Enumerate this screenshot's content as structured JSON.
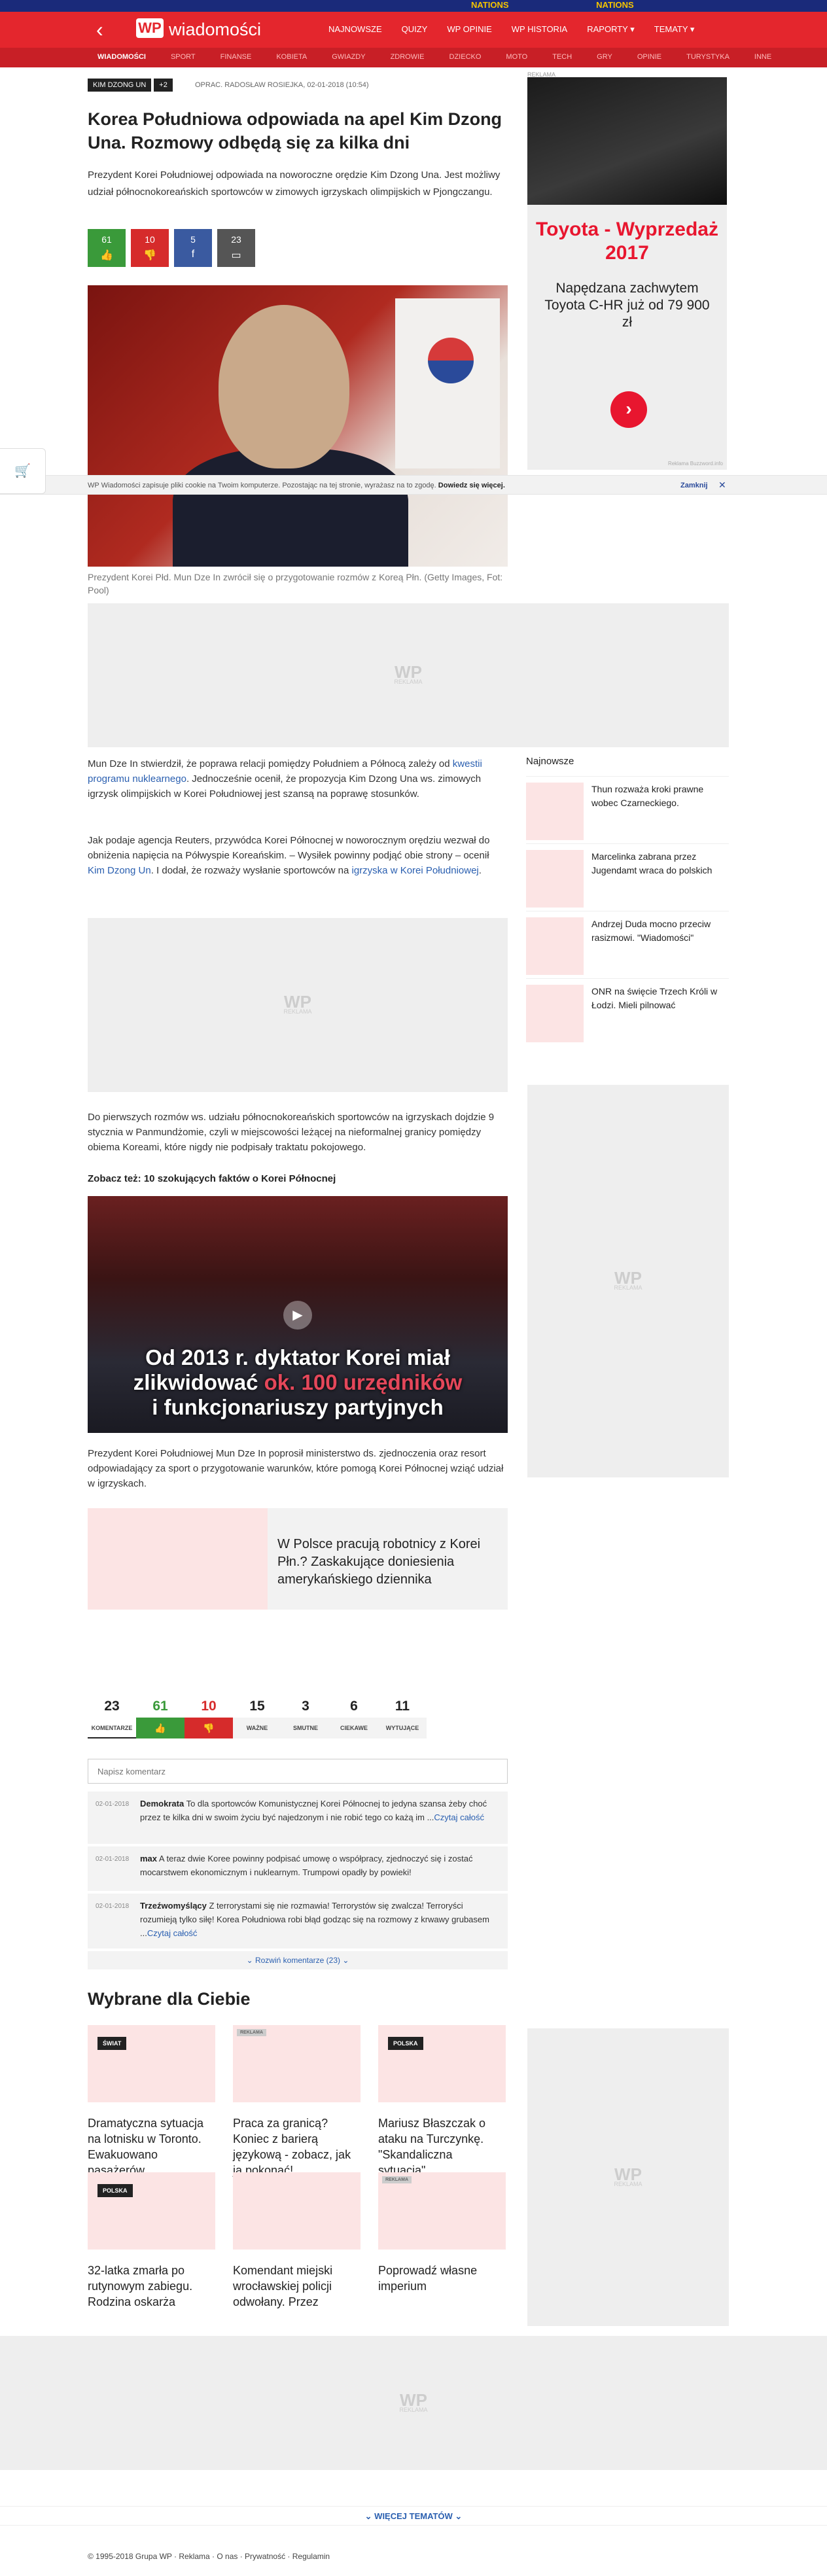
{
  "top_banner": {
    "left": "NATIONS",
    "right": "NATIONS"
  },
  "header": {
    "back_glyph": "‹",
    "logo": "WP",
    "brand": "wiadomości",
    "nav": [
      "NAJNOWSZE",
      "QUIZY",
      "WP OPINIE",
      "WP HISTORIA",
      "RAPORTY ▾",
      "TEMATY ▾"
    ]
  },
  "subnav": [
    "WIADOMOŚCI",
    "SPORT",
    "FINANSE",
    "KOBIETA",
    "GWIAZDY",
    "ZDROWIE",
    "DZIECKO",
    "MOTO",
    "TECH",
    "GRY",
    "OPINIE",
    "TURYSTYKA",
    "INNE"
  ],
  "article": {
    "tags": [
      "KIM DZONG UN",
      "+2"
    ],
    "meta": "OPRAC. RADOSŁAW ROSIEJKA, 02-01-2018 (10:54)",
    "title": "Korea Południowa odpowiada na apel Kim Dzong Una. Rozmowy odbędą się za kilka dni",
    "lead": "Prezydent Korei Południowej odpowiada na noworoczne orędzie Kim Dzong Una. Jest możliwy udział północnokoreańskich sportowców w zimowych igrzyskach olimpijskich w Pjongczangu.",
    "votes": [
      {
        "value": "61",
        "icon": "👍",
        "kind": "like"
      },
      {
        "value": "10",
        "icon": "👎",
        "kind": "dislike"
      },
      {
        "value": "5",
        "icon": "f",
        "kind": "facebook"
      },
      {
        "value": "23",
        "icon": "▭",
        "kind": "comments"
      }
    ],
    "caption": "Prezydent Korei Płd. Mun Dze In zwrócił się o przygotowanie rozmów z Koreą Płn. (Getty Images, Fot: Pool)",
    "p1_a": "Mun Dze In stwierdził, że poprawa relacji pomiędzy Południem a Północą zależy od ",
    "p1_link": "kwestii programu nuklearnego",
    "p1_b": ". Jednocześnie ocenił, że propozycja Kim Dzong Una ws. zimowych igrzysk olimpijskich w Korei Południowej jest szansą na poprawę stosunków.",
    "p2_a": "Jak podaje agencja Reuters, przywódca Korei Północnej w noworocznym orędziu wezwał do obniżenia napięcia na Półwyspie Koreańskim. – Wysiłek powinny podjąć obie strony – ocenił ",
    "p2_link1": "Kim Dzong Un",
    "p2_b": ". I dodał, że rozważy wysłanie sportowców na ",
    "p2_link2": "igrzyska w Korei Południowej",
    "p2_c": ".",
    "p3": "Do pierwszych rozmów ws. udziału północnokoreańskich sportowców na igrzyskach dojdzie 9 stycznia w Panmundżomie, czyli w miejscowości leżącej na nieformalnej granicy pomiędzy obiema Koreami, które nigdy nie podpisały traktatu pokojowego.",
    "see_also": "Zobacz też: 10 szokujących faktów o Korei Północnej",
    "gallery_line1": "Od 2013 r. dyktator Korei miał",
    "gallery_line2a": "zlikwidować ",
    "gallery_line2b": "ok. 100 urzędników",
    "gallery_line3": "i funkcjonariuszy partyjnych",
    "p4": "Prezydent Korei Południowej Mun Dze In poprosił ministerstwo ds. zjednoczenia oraz resort odpowiadający za sport o przygotowanie warunków, które pomogą Korei Północnej wziąć udział w igrzyskach.",
    "promo": "W Polsce pracują robotnicy z Korei Płn.? Zaskakujące doniesienia amerykańskiego dziennika"
  },
  "ads": {
    "label": "REKLAMA",
    "wp": "WP",
    "reklama": "REKLAMA"
  },
  "side_ad": {
    "title": "Toyota - Wyprzedaż 2017",
    "text": "Napędzana zachwytem Toyota C-HR już od 79 900 zł",
    "arrow": "›",
    "footer": "Reklama Buzzword.info"
  },
  "cookie": {
    "text": "WP Wiadomości zapisuje pliki cookie na Twoim komputerze. Pozostając na tej stronie, wyrażasz na to zgodę. ",
    "bold": "Dowiedz się więcej.",
    "close_label": "Zamknij",
    "close_x": "✕"
  },
  "cart_icon": "🛒",
  "related": {
    "heading": "Najnowsze",
    "items": [
      "Thun rozważa kroki prawne wobec Czarneckiego.",
      "Marcelinka zabrana przez Jugendamt wraca do polskich",
      "Andrzej Duda mocno przeciw rasizmowi. \"Wiadomości\"",
      "ONR na święcie Trzech Króli w Łodzi. Mieli pilnować"
    ]
  },
  "comments": {
    "stats": [
      {
        "n": "23",
        "l": "KOMENTARZE",
        "kind": "active"
      },
      {
        "n": "61",
        "l": "👍",
        "kind": "g"
      },
      {
        "n": "10",
        "l": "👎",
        "kind": "r"
      },
      {
        "n": "15",
        "l": "WAŻNE",
        "kind": ""
      },
      {
        "n": "3",
        "l": "SMUTNE",
        "kind": ""
      },
      {
        "n": "6",
        "l": "CIEKAWE",
        "kind": ""
      },
      {
        "n": "11",
        "l": "WYTUJĄCE",
        "kind": ""
      }
    ],
    "placeholder": "Napisz komentarz",
    "items": [
      {
        "date": "02-01-2018",
        "author": "Demokrata",
        "text": " To dla sportowców Komunistycznej Korei Północnej to jedyna szansa żeby choć przez te kilka dni w swoim życiu być najedzonym i nie robić tego co każą im ...",
        "more": "Czytaj całość"
      },
      {
        "date": "02-01-2018",
        "author": "max",
        "text": " A teraz dwie Koree powinny podpisać umowę o współpracy, zjednoczyć się i zostać mocarstwem ekonomicznym i nuklearnym. Trumpowi opadły by powieki!",
        "more": ""
      },
      {
        "date": "02-01-2018",
        "author": "Trzeźwomyślący",
        "text": " Z terrorystami się nie rozmawia! Terrorystów się zwalcza! Terroryści rozumieją tylko siłę! Korea Południowa robi błąd godząc się na rozmowy z krwawy grubasem ...",
        "more": "Czytaj całość"
      }
    ],
    "more": "⌄ Rozwiń komentarze (23) ⌄"
  },
  "for_you": {
    "heading": "Wybrane dla Ciebie",
    "items": [
      {
        "badge": "ŚWIAT",
        "title": "Dramatyczna sytuacja na lotnisku w Toronto. Ewakuowano pasażerów"
      },
      {
        "badge": "REKLAMA",
        "title": "Praca za granicą? Koniec z barierą językową - zobacz, jak ją pokonać!"
      },
      {
        "badge": "POLSKA",
        "title": "Mariusz Błaszczak o ataku na Turczynkę. \"Skandaliczna sytuacja\","
      },
      {
        "badge": "POLSKA",
        "title": "32-latka zmarła po rutynowym zabiegu. Rodzina oskarża"
      },
      {
        "badge": "",
        "title": "Komendant miejski wrocławskiej policji odwołany. Przez"
      },
      {
        "badge": "REKLAMA",
        "title": "Poprowadź własne imperium"
      }
    ]
  },
  "more_topics": "⌄ WIĘCEJ TEMATÓW ⌄",
  "footer": "© 1995-2018 Grupa WP · Reklama · O nas · Prywatność · Regulamin"
}
